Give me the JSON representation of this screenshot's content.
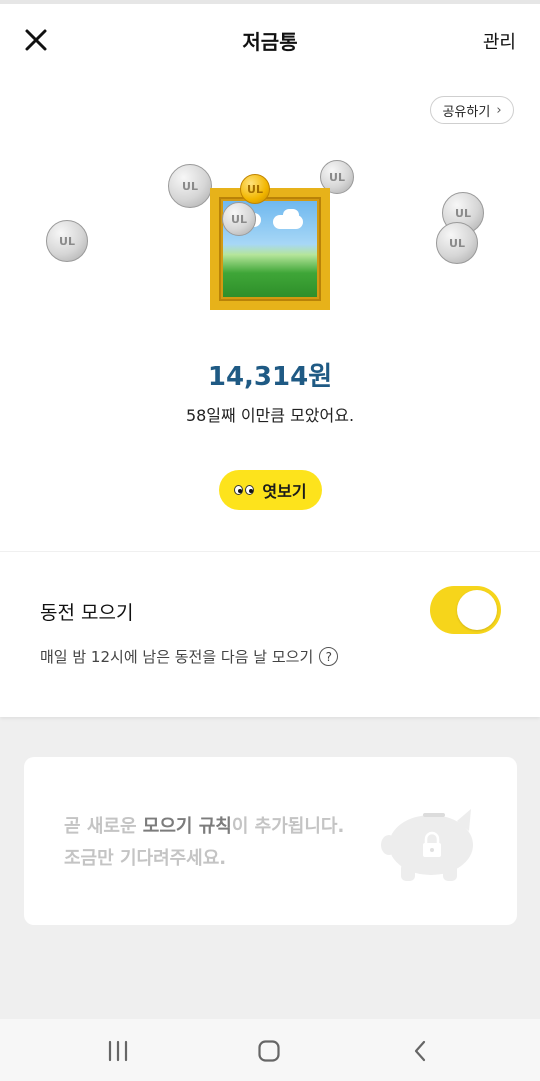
{
  "header": {
    "title": "저금통",
    "manage_label": "관리"
  },
  "share": {
    "label": "공유하기"
  },
  "illustration": {
    "coin_mark": "UL"
  },
  "savings": {
    "amount": "14,314원",
    "subtext": "58일째 이만큼 모았어요."
  },
  "peek_button": {
    "label": "엿보기"
  },
  "coin_collect": {
    "label": "동전 모으기",
    "description": "매일 밤 12시에 남은 동전을 다음 날 모으기",
    "help": "?",
    "enabled": true
  },
  "notice": {
    "line1_prefix": "곧 새로운 ",
    "line1_strong": "모으기 규칙",
    "line1_suffix": "이 추가됩니다.",
    "line2": "조금만 기다려주세요."
  },
  "colors": {
    "accent_yellow": "#fde31c",
    "amount_blue": "#1f5a84"
  },
  "navbar": {
    "icons": [
      "recent-apps-icon",
      "home-icon",
      "back-icon"
    ]
  }
}
